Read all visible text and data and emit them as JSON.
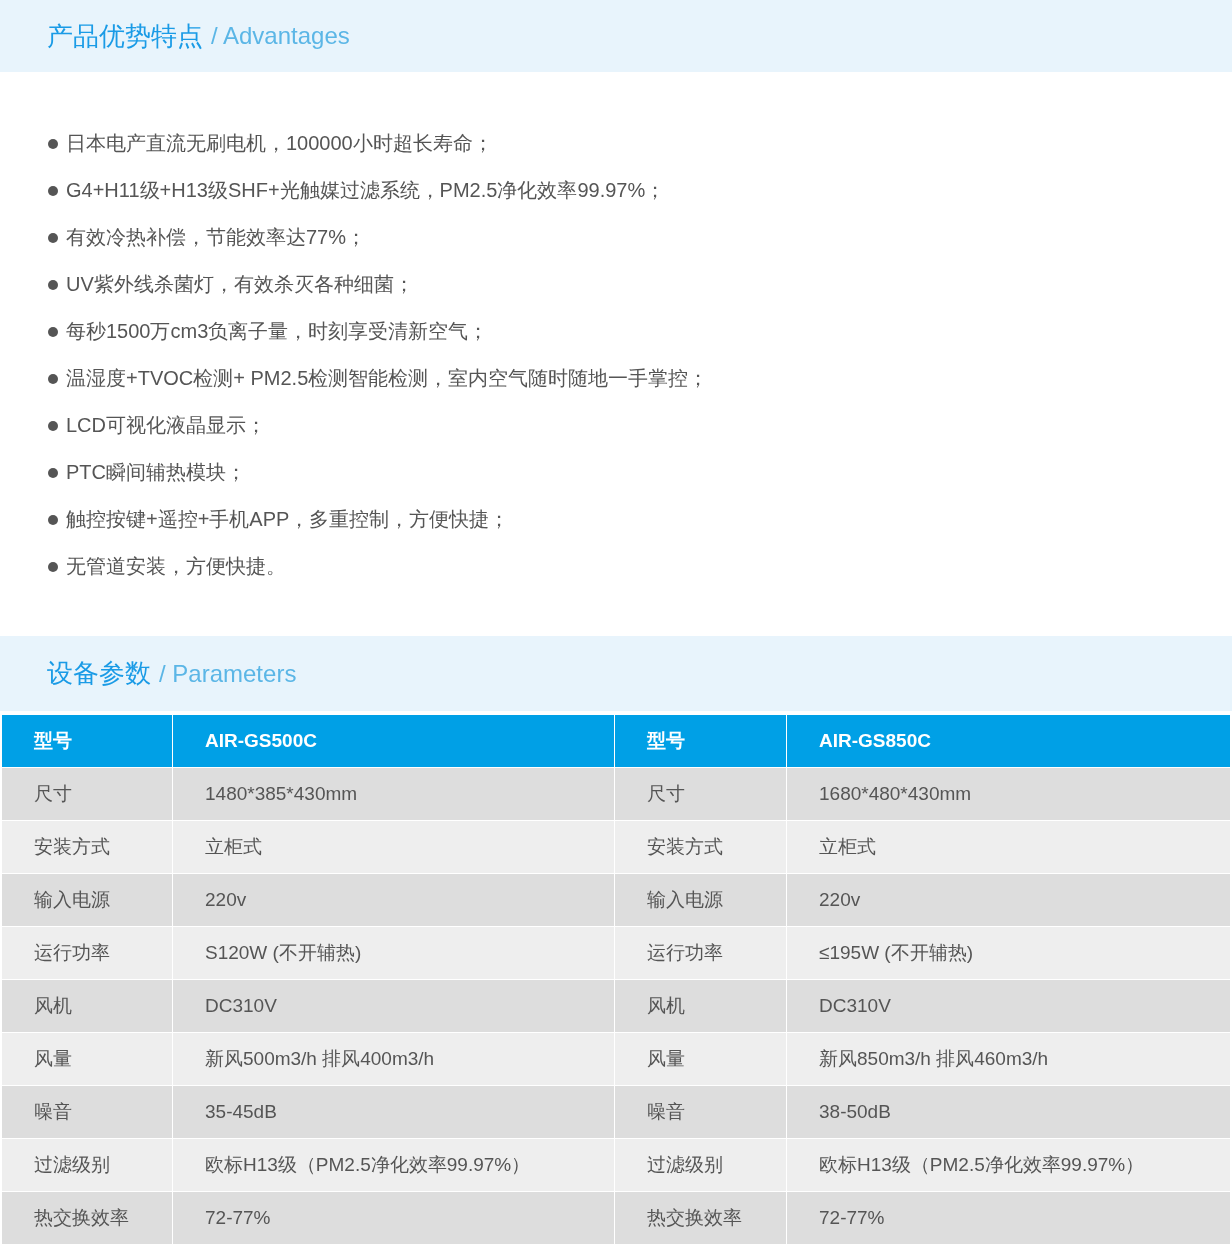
{
  "advantages": {
    "title": "产品优势特点",
    "subtitle": "/ Advantages",
    "items": [
      "日本电产直流无刷电机，100000小时超长寿命；",
      "G4+H11级+H13级SHF+光触媒过滤系统，PM2.5净化效率99.97%；",
      "有效冷热补偿，节能效率达77%；",
      "UV紫外线杀菌灯，有效杀灭各种细菌；",
      "每秒1500万cm3负离子量，时刻享受清新空气；",
      "温湿度+TVOC检测+ PM2.5检测智能检测，室内空气随时随地一手掌控；",
      "LCD可视化液晶显示；",
      "PTC瞬间辅热模块；",
      "触控按键+遥控+手机APP，多重控制，方便快捷；",
      "无管道安装，方便快捷。"
    ]
  },
  "parameters": {
    "title": "设备参数",
    "subtitle": "/ Parameters",
    "table": {
      "header": [
        "型号",
        "AIR-GS500C",
        "型号",
        "AIR-GS850C"
      ],
      "rows": [
        [
          "尺寸",
          "1480*385*430mm",
          "尺寸",
          "1680*480*430mm"
        ],
        [
          "安装方式",
          "立柜式",
          "安装方式",
          "立柜式"
        ],
        [
          "输入电源",
          "220v",
          "输入电源",
          "220v"
        ],
        [
          "运行功率",
          "S120W (不开辅热)",
          "运行功率",
          "≤195W (不开辅热)"
        ],
        [
          "风机",
          "DC310V",
          "风机",
          "DC310V"
        ],
        [
          "风量",
          "新风500m3/h 排风400m3/h",
          "风量",
          "新风850m3/h 排风460m3/h"
        ],
        [
          "噪音",
          "35-45dB",
          "噪音",
          "38-50dB"
        ],
        [
          "过滤级别",
          "欧标H13级（PM2.5净化效率99.97%）",
          "过滤级别",
          "欧标H13级（PM2.5净化效率99.97%）"
        ],
        [
          "热交换效率",
          "72-77%",
          "热交换效率",
          "72-77%"
        ]
      ]
    }
  }
}
